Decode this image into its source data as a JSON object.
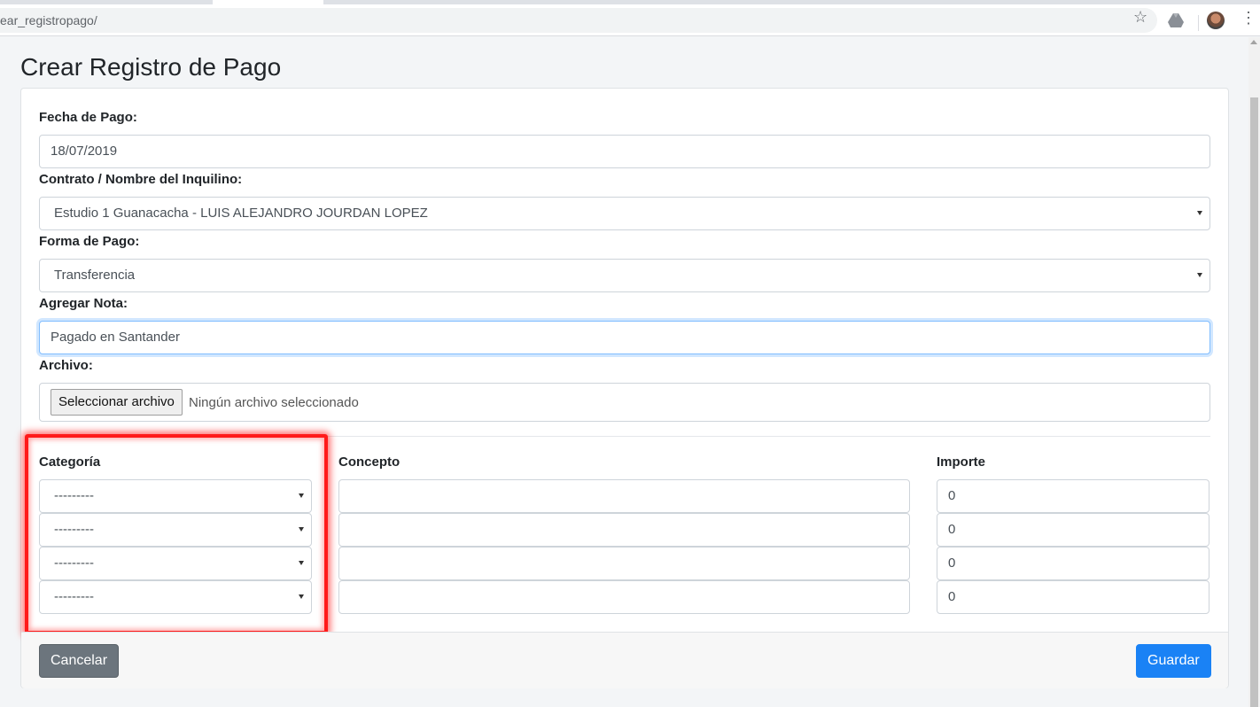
{
  "browser": {
    "url": "ear_registropago/"
  },
  "page": {
    "title": "Crear Registro de Pago"
  },
  "form": {
    "fecha_label": "Fecha de Pago:",
    "fecha_value": "18/07/2019",
    "contrato_label": "Contrato / Nombre del Inquilino:",
    "contrato_value": "Estudio 1 Guanacacha - LUIS ALEJANDRO JOURDAN LOPEZ",
    "forma_label": "Forma de Pago:",
    "forma_value": "Transferencia",
    "nota_label": "Agregar Nota:",
    "nota_value": "Pagado en Santander",
    "archivo_label": "Archivo:",
    "archivo_button": "Seleccionar archivo",
    "archivo_status": "Ningún archivo seleccionado"
  },
  "items": {
    "headers": {
      "categoria": "Categoría",
      "concepto": "Concepto",
      "importe": "Importe"
    },
    "rows": [
      {
        "categoria": "---------",
        "concepto": "",
        "importe": "0"
      },
      {
        "categoria": "---------",
        "concepto": "",
        "importe": "0"
      },
      {
        "categoria": "---------",
        "concepto": "",
        "importe": "0"
      },
      {
        "categoria": "---------",
        "concepto": "",
        "importe": "0"
      }
    ]
  },
  "footer": {
    "cancel_label": "Cancelar",
    "save_label": "Guardar"
  },
  "colors": {
    "primary": "#1a82f5",
    "secondary": "#6c757d",
    "highlight": "#ff1a1a"
  }
}
